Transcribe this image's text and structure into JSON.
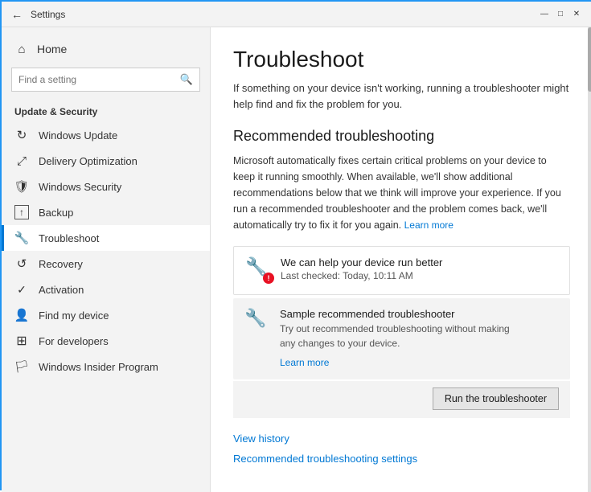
{
  "titleBar": {
    "title": "Settings",
    "back": "←",
    "minimize": "—",
    "maximize": "□",
    "close": "✕"
  },
  "sidebar": {
    "homeLabel": "Home",
    "searchPlaceholder": "Find a setting",
    "sectionTitle": "Update & Security",
    "items": [
      {
        "id": "windows-update",
        "label": "Windows Update",
        "icon": "↻"
      },
      {
        "id": "delivery-optimization",
        "label": "Delivery Optimization",
        "icon": "⤢"
      },
      {
        "id": "windows-security",
        "label": "Windows Security",
        "icon": "🛡"
      },
      {
        "id": "backup",
        "label": "Backup",
        "icon": "↑"
      },
      {
        "id": "troubleshoot",
        "label": "Troubleshoot",
        "icon": "🔧"
      },
      {
        "id": "recovery",
        "label": "Recovery",
        "icon": "↺"
      },
      {
        "id": "activation",
        "label": "Activation",
        "icon": "✓"
      },
      {
        "id": "find-my-device",
        "label": "Find my device",
        "icon": "👤"
      },
      {
        "id": "for-developers",
        "label": "For developers",
        "icon": "⊞"
      },
      {
        "id": "windows-insider",
        "label": "Windows Insider Program",
        "icon": "🏳"
      }
    ]
  },
  "main": {
    "pageTitle": "Troubleshoot",
    "pageSubtitle": "If something on your device isn't working, running a troubleshooter might help find and fix the problem for you.",
    "sectionTitle": "Recommended troubleshooting",
    "sectionDescription": "Microsoft automatically fixes certain critical problems on your device to keep it running smoothly. When available, we'll show additional recommendations below that we think will improve your experience. If you run a recommended troubleshooter and the problem comes back, we'll automatically try to fix it for you again.",
    "learnMoreInline": "Learn more",
    "card1": {
      "title": "We can help your device run better",
      "subtitle": "Last checked: Today, 10:11 AM",
      "hasError": true,
      "errorText": "!"
    },
    "card2": {
      "title": "Sample recommended troubleshooter",
      "desc1": "Try out recommended troubleshooting without making",
      "desc2": "any changes to your device.",
      "linkLabel": "Learn more"
    },
    "runBtnLabel": "Run the troubleshooter",
    "bottomLinks": [
      {
        "id": "view-history",
        "label": "View history"
      },
      {
        "id": "recommended-settings",
        "label": "Recommended troubleshooting settings"
      }
    ]
  }
}
